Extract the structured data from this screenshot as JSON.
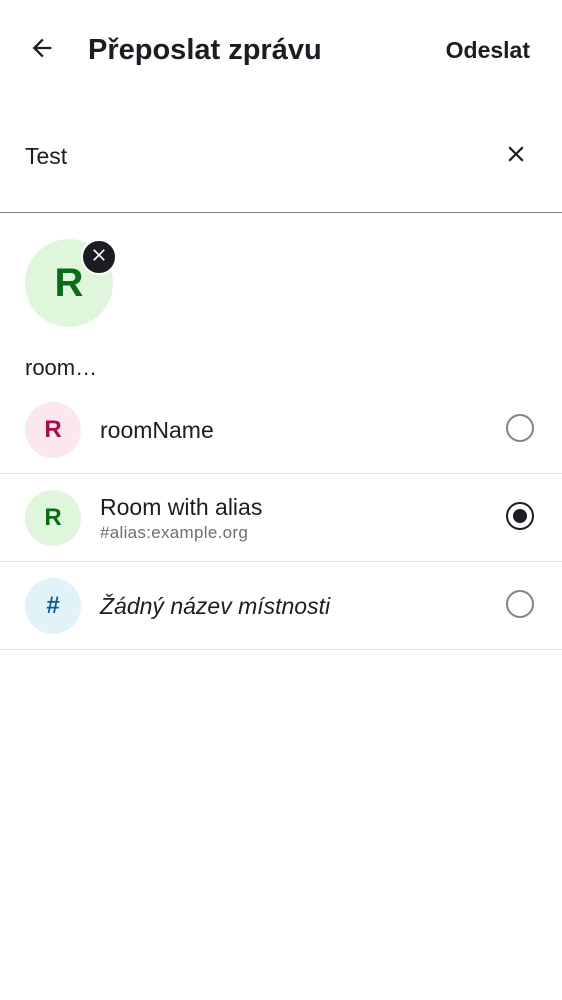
{
  "header": {
    "title": "Přeposlat zprávu",
    "send_label": "Odeslat",
    "back_icon": "arrow-left-icon"
  },
  "search": {
    "value": "Test",
    "clear_icon": "close-icon"
  },
  "selected": {
    "chips": [
      {
        "initial": "R",
        "label": "room…",
        "avatar_bg": "#dff6dc",
        "avatar_fg": "#0a6b1a"
      }
    ]
  },
  "rooms": [
    {
      "initial": "R",
      "name": "roomName",
      "alias": "",
      "italic": false,
      "selected": false,
      "avatar_bg": "#fde7ee",
      "avatar_fg": "#a3104a"
    },
    {
      "initial": "R",
      "name": "Room with alias",
      "alias": "#alias:example.org",
      "italic": false,
      "selected": true,
      "avatar_bg": "#dff6dc",
      "avatar_fg": "#0a6b1a"
    },
    {
      "initial": "#",
      "name": "Žádný název místnosti",
      "alias": "",
      "italic": true,
      "selected": false,
      "avatar_bg": "#e2f2f9",
      "avatar_fg": "#0d5d86"
    }
  ]
}
